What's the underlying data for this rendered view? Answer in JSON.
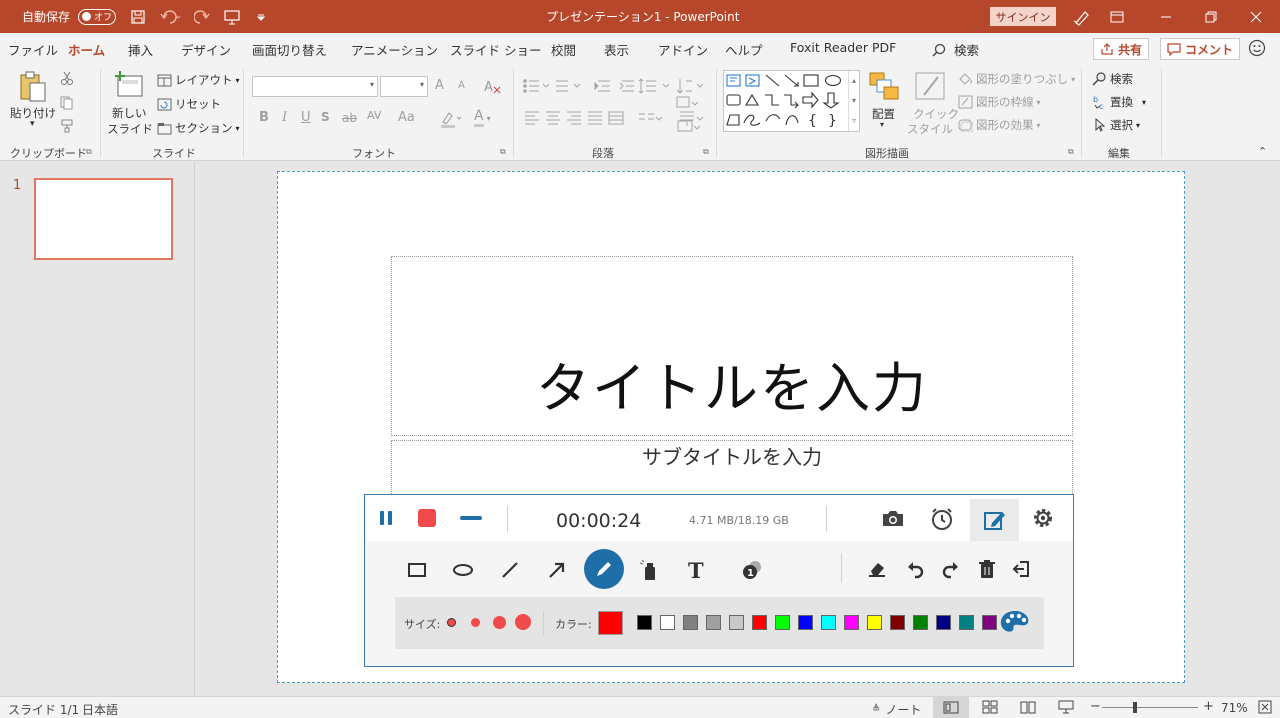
{
  "titlebar": {
    "autosave_label": "自動保存",
    "autosave_state": "オフ",
    "title": "プレゼンテーション1  -  PowerPoint",
    "signin": "サインイン"
  },
  "menu": {
    "tabs": [
      "ファイル",
      "ホーム",
      "挿入",
      "デザイン",
      "画面切り替え",
      "アニメーション",
      "スライド ショー",
      "校閲",
      "表示",
      "アドイン",
      "ヘルプ",
      "Foxit Reader PDF"
    ],
    "active_tab": "ホーム",
    "search": "検索",
    "share": "共有",
    "comment": "コメント"
  },
  "ribbon": {
    "clipboard": {
      "paste": "貼り付け",
      "label": "クリップボード"
    },
    "slides": {
      "new_slide_1": "新しい",
      "new_slide_2": "スライド",
      "layout": "レイアウト",
      "reset": "リセット",
      "section": "セクション",
      "label": "スライド"
    },
    "font": {
      "label": "フォント",
      "grow": "A",
      "shrink": "A",
      "bold": "B",
      "italic": "I",
      "underline": "U",
      "strike": "ab",
      "spacing": "AV",
      "case": "Aa",
      "color": "A"
    },
    "paragraph": {
      "label": "段落"
    },
    "drawing": {
      "arrange": "配置",
      "quick_style_1": "クイック",
      "quick_style_2": "スタイル",
      "fill": "図形の塗りつぶし",
      "outline": "図形の枠線",
      "effects": "図形の効果",
      "label": "図形描画"
    },
    "editing": {
      "find": "検索",
      "replace": "置換",
      "select": "選択",
      "label": "編集"
    }
  },
  "slides_panel": {
    "number": "1"
  },
  "slide": {
    "title": "タイトルを入力",
    "subtitle": "サブタイトルを入力"
  },
  "recorder": {
    "timer": "00:00:24",
    "storage": "4.71 MB/18.19 GB",
    "size_label": "サイズ:",
    "color_label": "カラー:",
    "current_color": "#ff0000",
    "colors": [
      "#000000",
      "#ffffff",
      "#808080",
      "#a0a0a0",
      "#c8c8c8",
      "#ff0000",
      "#00ff00",
      "#0000ff",
      "#00ffff",
      "#ff00ff",
      "#ffff00",
      "#800000",
      "#008000",
      "#000080",
      "#008080",
      "#800080"
    ],
    "tools": [
      "rectangle-icon",
      "ellipse-icon",
      "line-icon",
      "arrow-icon",
      "pen-icon",
      "highlighter-icon",
      "text-icon",
      "number-icon",
      "eraser-icon",
      "undo-icon",
      "redo-icon",
      "trash-icon",
      "exit-icon"
    ]
  },
  "statusbar": {
    "slide": "スライド 1/1",
    "language": "日本語",
    "notes": "ノート",
    "zoom": "71%"
  }
}
